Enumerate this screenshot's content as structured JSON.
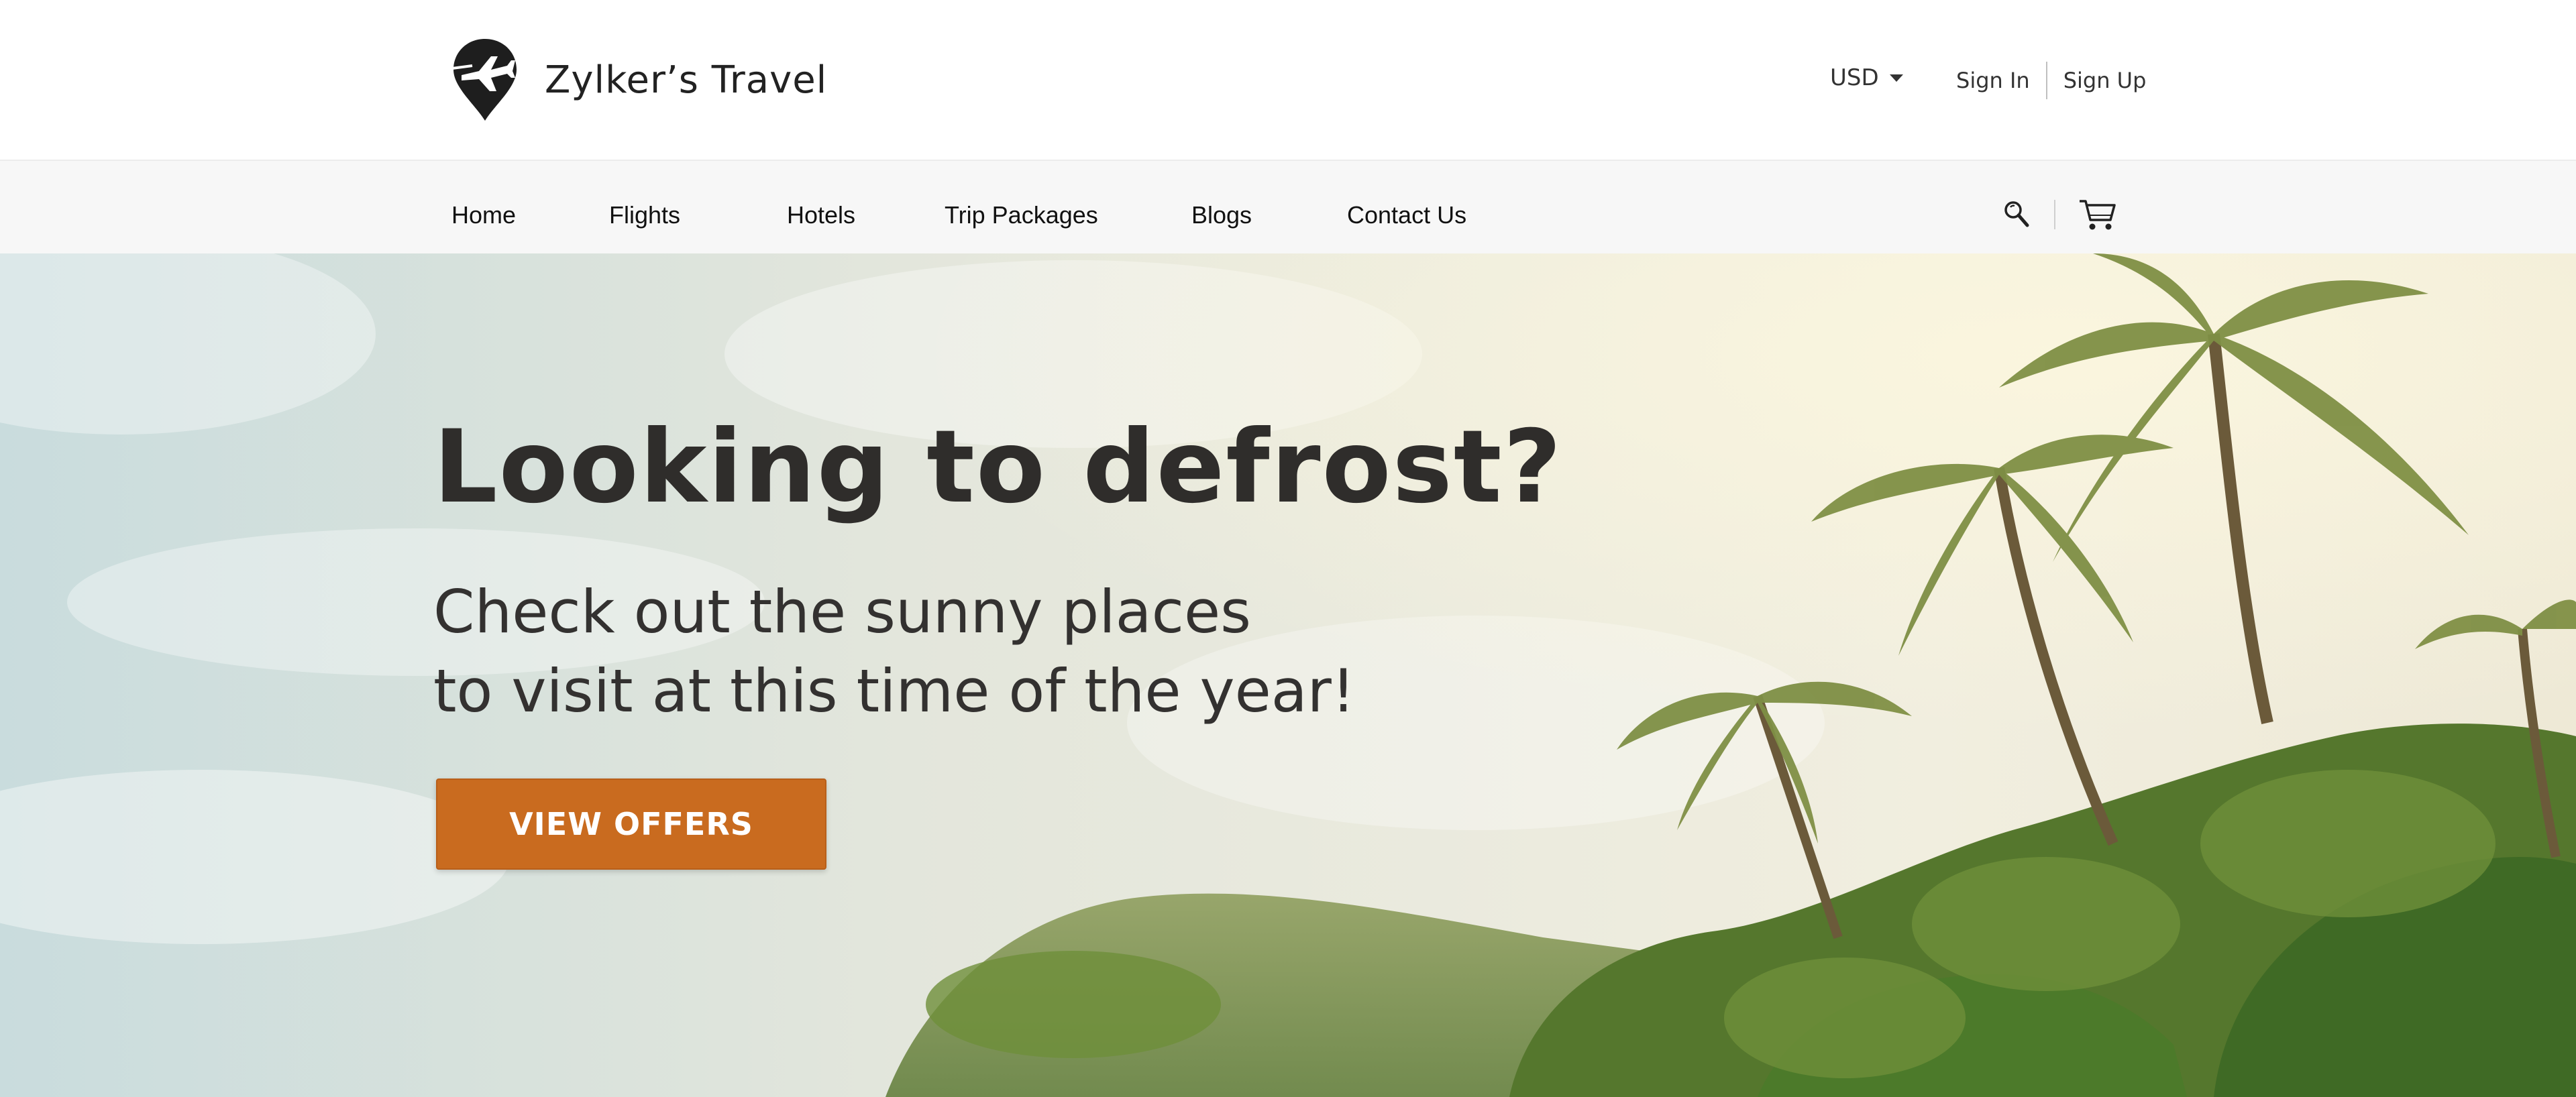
{
  "header": {
    "brand_name": "Zylker’s Travel",
    "logo_icon": "map-pin-airplane-icon",
    "currency": {
      "selected": "USD",
      "icon": "caret-down-icon"
    },
    "auth": {
      "sign_in": "Sign In",
      "sign_up": "Sign Up"
    }
  },
  "nav": {
    "items": [
      {
        "label": "Home"
      },
      {
        "label": "Flights"
      },
      {
        "label": "Hotels"
      },
      {
        "label": "Trip Packages"
      },
      {
        "label": "Blogs"
      },
      {
        "label": "Contact Us"
      }
    ],
    "search_icon": "search-icon",
    "cart_icon": "shopping-cart-icon"
  },
  "hero": {
    "title": "Looking to defrost?",
    "subtitle_line1": "Check out the sunny places",
    "subtitle_line2": "to visit at this time of the year!",
    "cta_label": "VIEW OFFERS",
    "background": "tropical-palm-trees-sunny-sky-image"
  },
  "colors": {
    "accent": "#C96B1F",
    "nav_background": "#F7F7F7",
    "heading_text": "#2F2D2B",
    "header_text": "#333333"
  }
}
